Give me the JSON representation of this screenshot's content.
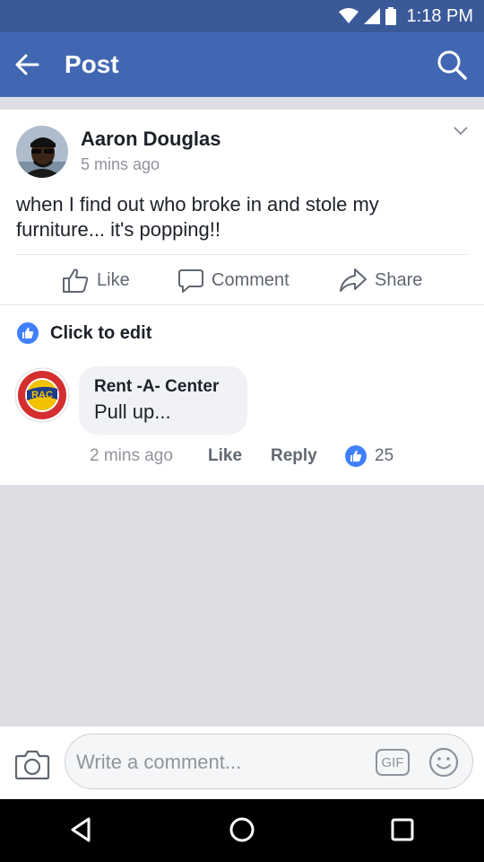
{
  "status_bar": {
    "time": "1:18 PM"
  },
  "header": {
    "title": "Post",
    "back_icon": "arrow-left-icon",
    "search_icon": "search-icon"
  },
  "post": {
    "author": "Aaron Douglas",
    "time": "5 mins ago",
    "text": "when I find out who broke in and stole my furniture... it's popping!!",
    "actions": {
      "like": "Like",
      "comment": "Comment",
      "share": "Share"
    },
    "click_to_edit": "Click to edit"
  },
  "comment": {
    "author": "Rent -A- Center",
    "text": "Pull up...",
    "time": "2 mins ago",
    "like": "Like",
    "reply": "Reply",
    "reaction_count": "25",
    "avatar_logo_text": "RAC"
  },
  "composer": {
    "placeholder": "Write a comment...",
    "gif_label": "GIF"
  },
  "colors": {
    "brand": "#4267b2",
    "status_bar": "#3a5999",
    "like_blue": "#4080ff"
  }
}
